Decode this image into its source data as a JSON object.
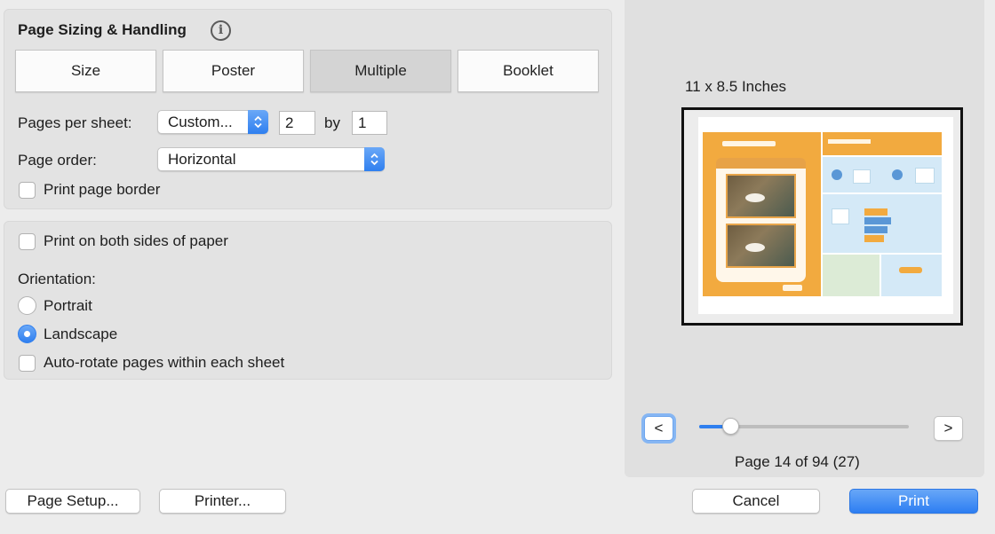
{
  "section": {
    "title": "Page Sizing & Handling"
  },
  "layout_modes": {
    "size": "Size",
    "poster": "Poster",
    "multiple": "Multiple",
    "booklet": "Booklet",
    "selected": "Multiple"
  },
  "pages_per_sheet": {
    "label": "Pages per sheet:",
    "preset": "Custom...",
    "columns": "2",
    "by_label": "by",
    "rows": "1"
  },
  "page_order": {
    "label": "Page order:",
    "value": "Horizontal"
  },
  "print_page_border": {
    "label": "Print page border",
    "checked": false
  },
  "duplex": {
    "label": "Print on both sides of paper",
    "checked": false
  },
  "orientation": {
    "label": "Orientation:",
    "portrait": "Portrait",
    "landscape": "Landscape",
    "selected": "Landscape"
  },
  "auto_rotate": {
    "label": "Auto-rotate pages within each sheet",
    "checked": false
  },
  "preview": {
    "paper_size": "11 x 8.5 Inches",
    "prev": "<",
    "next": ">",
    "page_status": "Page 14 of 94 (27)",
    "slider_fraction": 0.149
  },
  "buttons": {
    "page_setup": "Page Setup...",
    "printer": "Printer...",
    "cancel": "Cancel",
    "print": "Print"
  },
  "colors": {
    "accent": "#2f7fef",
    "thumbnail_orange": "#f2aa3f",
    "thumbnail_blue": "#d4e9f7",
    "thumbnail_green": "#dcebd6"
  }
}
